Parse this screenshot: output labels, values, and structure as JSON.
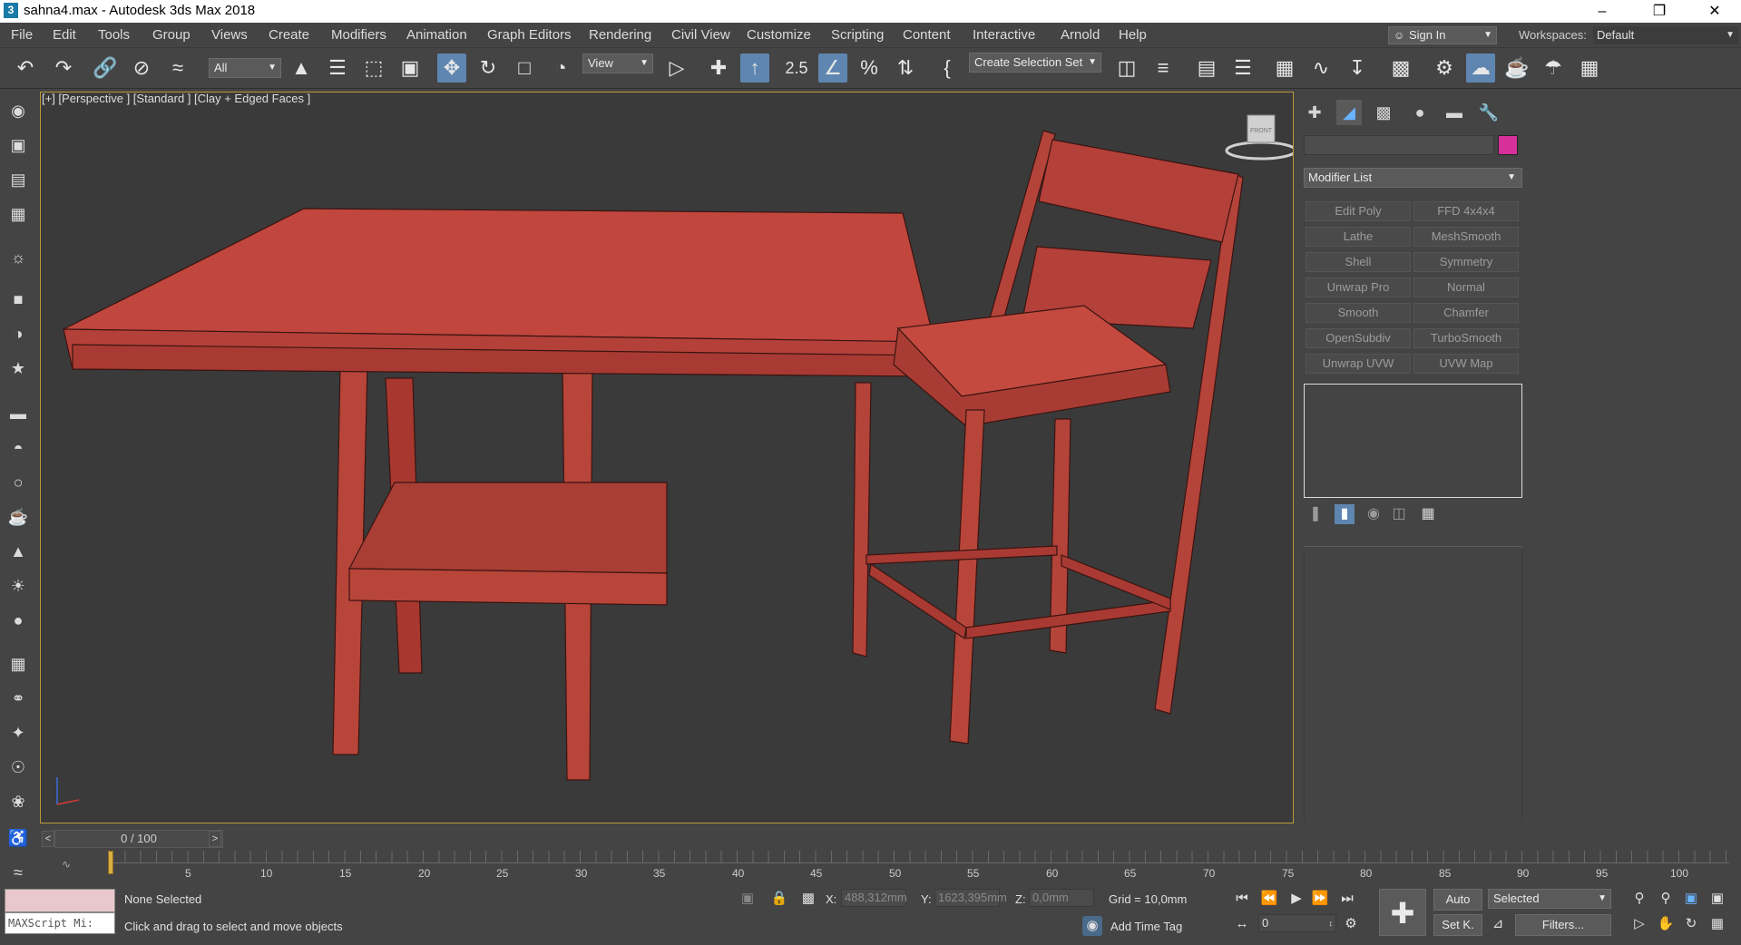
{
  "window": {
    "title": "sahna4.max - Autodesk 3ds Max 2018",
    "app_icon": "3ds-max-icon",
    "minimize": "–",
    "maximize": "❐",
    "close": "✕"
  },
  "menu": [
    "File",
    "Edit",
    "Tools",
    "Group",
    "Views",
    "Create",
    "Modifiers",
    "Animation",
    "Graph Editors",
    "Rendering",
    "Civil View",
    "Customize",
    "Scripting",
    "Content",
    "Interactive",
    "Arnold",
    "Help"
  ],
  "account": {
    "signin_label": "Sign In",
    "workspaces_label": "Workspaces:",
    "workspace_value": "Default"
  },
  "toolbar": {
    "selection_filter": "All",
    "ref_coord": "View",
    "selection_set": "Create Selection Set",
    "snap_label": "2.5"
  },
  "viewport": {
    "label": "[+] [Perspective ] [Standard ] [Clay + Edged Faces ]",
    "viewcube_label": "FRONT",
    "object_color": "#c0463e"
  },
  "command_panel": {
    "color_swatch": "#d8309a",
    "modifier_list": "Modifier List",
    "modifier_buttons": [
      "Edit Poly",
      "FFD 4x4x4",
      "Lathe",
      "MeshSmooth",
      "Shell",
      "Symmetry",
      "Unwrap Pro",
      "Normal",
      "Smooth",
      "Chamfer",
      "OpenSubdiv",
      "TurboSmooth",
      "Unwrap UVW",
      "UVW Map"
    ]
  },
  "timeline": {
    "frame_display": "0 / 100",
    "ticks": [
      "5",
      "10",
      "15",
      "20",
      "25",
      "30",
      "35",
      "40",
      "45",
      "50",
      "55",
      "60",
      "65",
      "70",
      "75",
      "80",
      "85",
      "90",
      "95",
      "100"
    ]
  },
  "status": {
    "maxscript": "MAXScript Mi:",
    "selection": "None Selected",
    "prompt": "Click and drag to select and move objects",
    "x_label": "X:",
    "x_value": "488,312mm",
    "y_label": "Y:",
    "y_value": "1623,395mm",
    "z_label": "Z:",
    "z_value": "0,0mm",
    "grid": "Grid = 10,0mm",
    "add_time_tag": "Add Time Tag",
    "auto_key": "Auto",
    "key_mode": "Selected",
    "set_key": "Set K.",
    "filters": "Filters...",
    "frame_value": "0"
  }
}
